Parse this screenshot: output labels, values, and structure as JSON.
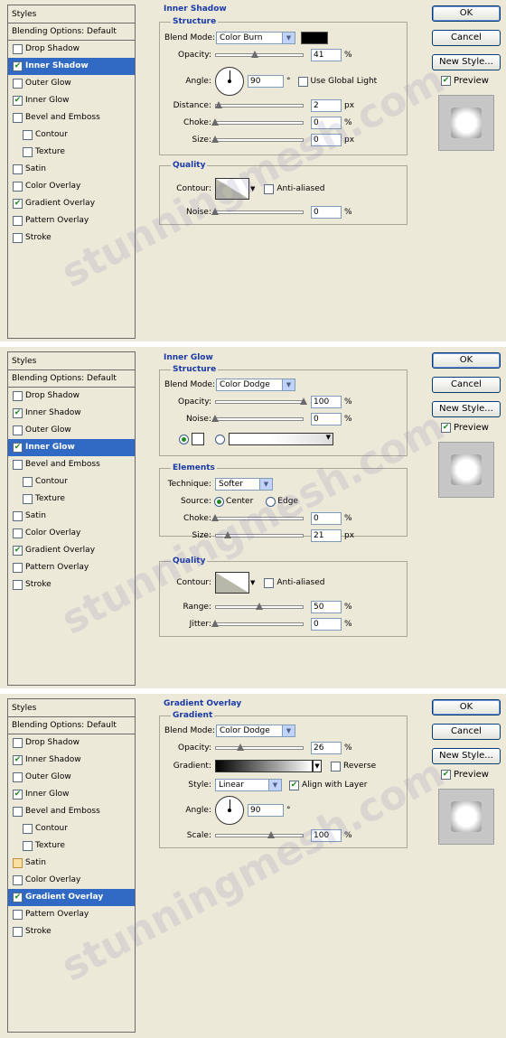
{
  "panels": [
    {
      "section": "Inner Shadow",
      "styles_header": "Styles",
      "blending_options": "Blending Options: Default",
      "items": [
        {
          "label": "Drop Shadow",
          "checked": false,
          "sub": false,
          "selected": false
        },
        {
          "label": "Inner Shadow",
          "checked": true,
          "sub": false,
          "selected": true
        },
        {
          "label": "Outer Glow",
          "checked": false,
          "sub": false,
          "selected": false
        },
        {
          "label": "Inner Glow",
          "checked": true,
          "sub": false,
          "selected": false
        },
        {
          "label": "Bevel and Emboss",
          "checked": false,
          "sub": false,
          "selected": false
        },
        {
          "label": "Contour",
          "checked": false,
          "sub": true,
          "selected": false
        },
        {
          "label": "Texture",
          "checked": false,
          "sub": true,
          "selected": false
        },
        {
          "label": "Satin",
          "checked": false,
          "sub": false,
          "selected": false
        },
        {
          "label": "Color Overlay",
          "checked": false,
          "sub": false,
          "selected": false
        },
        {
          "label": "Gradient Overlay",
          "checked": true,
          "sub": false,
          "selected": false
        },
        {
          "label": "Pattern Overlay",
          "checked": false,
          "sub": false,
          "selected": false
        },
        {
          "label": "Stroke",
          "checked": false,
          "sub": false,
          "selected": false
        }
      ],
      "structure_title": "Structure",
      "blend_mode_label": "Blend Mode:",
      "blend_mode_value": "Color Burn",
      "opacity_label": "Opacity:",
      "opacity_value": "41",
      "opacity_pct": 41,
      "angle_label": "Angle:",
      "angle_value": "90",
      "angle_unit": "°",
      "global_light_label": "Use Global Light",
      "distance_label": "Distance:",
      "distance_value": "2",
      "choke_label": "Choke:",
      "choke_value": "0",
      "size_label": "Size:",
      "size_value": "0",
      "px": "px",
      "pct": "%",
      "quality_title": "Quality",
      "contour_label": "Contour:",
      "anti_aliased_label": "Anti-aliased",
      "noise_label": "Noise:",
      "noise_value": "0"
    },
    {
      "section": "Inner Glow",
      "styles_header": "Styles",
      "blending_options": "Blending Options: Default",
      "items": [
        {
          "label": "Drop Shadow",
          "checked": false,
          "sub": false,
          "selected": false
        },
        {
          "label": "Inner Shadow",
          "checked": true,
          "sub": false,
          "selected": false
        },
        {
          "label": "Outer Glow",
          "checked": false,
          "sub": false,
          "selected": false
        },
        {
          "label": "Inner Glow",
          "checked": true,
          "sub": false,
          "selected": true
        },
        {
          "label": "Bevel and Emboss",
          "checked": false,
          "sub": false,
          "selected": false
        },
        {
          "label": "Contour",
          "checked": false,
          "sub": true,
          "selected": false
        },
        {
          "label": "Texture",
          "checked": false,
          "sub": true,
          "selected": false
        },
        {
          "label": "Satin",
          "checked": false,
          "sub": false,
          "selected": false
        },
        {
          "label": "Color Overlay",
          "checked": false,
          "sub": false,
          "selected": false
        },
        {
          "label": "Gradient Overlay",
          "checked": true,
          "sub": false,
          "selected": false
        },
        {
          "label": "Pattern Overlay",
          "checked": false,
          "sub": false,
          "selected": false
        },
        {
          "label": "Stroke",
          "checked": false,
          "sub": false,
          "selected": false
        }
      ],
      "structure_title": "Structure",
      "blend_mode_label": "Blend Mode:",
      "blend_mode_value": "Color Dodge",
      "opacity_label": "Opacity:",
      "opacity_value": "100",
      "noise_label": "Noise:",
      "noise_value": "0",
      "elements_title": "Elements",
      "technique_label": "Technique:",
      "technique_value": "Softer",
      "source_label": "Source:",
      "center_label": "Center",
      "edge_label": "Edge",
      "choke_label": "Choke:",
      "choke_value": "0",
      "size_label": "Size:",
      "size_value": "21",
      "quality_title": "Quality",
      "contour_label": "Contour:",
      "anti_aliased_label": "Anti-aliased",
      "range_label": "Range:",
      "range_value": "50",
      "jitter_label": "Jitter:",
      "jitter_value": "0",
      "px": "px",
      "pct": "%"
    },
    {
      "section": "Gradient Overlay",
      "styles_header": "Styles",
      "blending_options": "Blending Options: Default",
      "items": [
        {
          "label": "Drop Shadow",
          "checked": false,
          "sub": false,
          "selected": false
        },
        {
          "label": "Inner Shadow",
          "checked": true,
          "sub": false,
          "selected": false
        },
        {
          "label": "Outer Glow",
          "checked": false,
          "sub": false,
          "selected": false
        },
        {
          "label": "Inner Glow",
          "checked": true,
          "sub": false,
          "selected": false
        },
        {
          "label": "Bevel and Emboss",
          "checked": false,
          "sub": false,
          "selected": false
        },
        {
          "label": "Contour",
          "checked": false,
          "sub": true,
          "selected": false
        },
        {
          "label": "Texture",
          "checked": false,
          "sub": true,
          "selected": false
        },
        {
          "label": "Satin",
          "checked": false,
          "sub": false,
          "selected": false,
          "yellow": true
        },
        {
          "label": "Color Overlay",
          "checked": false,
          "sub": false,
          "selected": false
        },
        {
          "label": "Gradient Overlay",
          "checked": true,
          "sub": false,
          "selected": true
        },
        {
          "label": "Pattern Overlay",
          "checked": false,
          "sub": false,
          "selected": false
        },
        {
          "label": "Stroke",
          "checked": false,
          "sub": false,
          "selected": false
        }
      ],
      "gradient_title": "Gradient",
      "blend_mode_label": "Blend Mode:",
      "blend_mode_value": "Color Dodge",
      "opacity_label": "Opacity:",
      "opacity_value": "26",
      "gradient_label": "Gradient:",
      "reverse_label": "Reverse",
      "style_label": "Style:",
      "style_value": "Linear",
      "align_label": "Align with Layer",
      "angle_label": "Angle:",
      "angle_value": "90",
      "angle_unit": "°",
      "scale_label": "Scale:",
      "scale_value": "100",
      "pct": "%"
    }
  ],
  "buttons": {
    "ok": "OK",
    "cancel": "Cancel",
    "new_style": "New Style...",
    "preview": "Preview"
  },
  "watermark": "stunningmesh.com",
  "colors": {
    "selected": "#316ac5",
    "section_title": "#1a3aa8",
    "dialog_bg": "#ece9d8"
  }
}
